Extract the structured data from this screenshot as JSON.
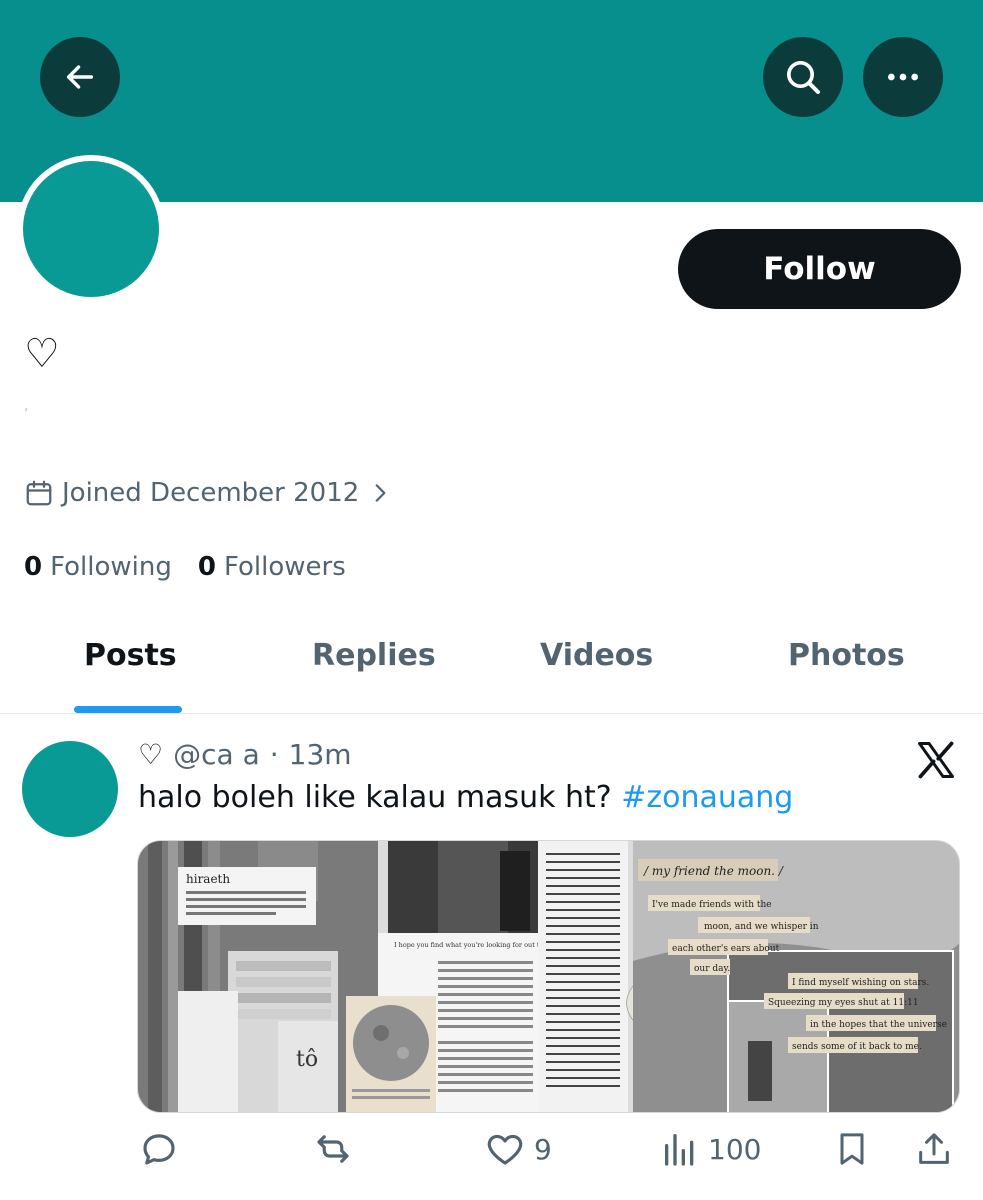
{
  "colors": {
    "banner": "#068f8c",
    "avatar": "#0a9a96",
    "button_dark": "#0b3b3b",
    "accent": "#1d9bf0",
    "text_primary": "#0f1419",
    "text_secondary": "#536471"
  },
  "header": {
    "back_icon": "arrow-left-icon",
    "search_icon": "search-icon",
    "more_icon": "more-horizontal-icon"
  },
  "profile": {
    "follow_label": "Follow",
    "display_name": "♡",
    "joined_text": "Joined December 2012",
    "following_count": "0",
    "following_label": "Following",
    "followers_count": "0",
    "followers_label": "Followers"
  },
  "tabs": [
    {
      "label": "Posts",
      "active": true
    },
    {
      "label": "Replies",
      "active": false
    },
    {
      "label": "Videos",
      "active": false
    },
    {
      "label": "Photos",
      "active": false
    }
  ],
  "post": {
    "name_icon": "♡",
    "handle": "@ca     a",
    "separator": "·",
    "time": "13m",
    "text": "halo boleh like kalau masuk ht?",
    "hashtag": "#zonauang",
    "collage_text": {
      "hiraeth_title": "hiraeth",
      "hiraeth_def": "(n.) a homesickness for a home to which you cannot return, a home which maybe never was; the nostalgia, the yearning, the grief for the lost places of your past",
      "moon_title": "/ my friend the moon. /",
      "moon_line1": "I've made friends with the",
      "moon_line2": "moon, and we whisper in",
      "moon_line3": "each other's ears about",
      "moon_line4": "our day.",
      "moon_line5": "I find myself wishing on stars.",
      "moon_line6": "Squeezing my eyes shut at 11:11",
      "moon_line7": "in the hopes that the universe",
      "moon_line8": "sends some of it back to me.",
      "letter_line1": "I hope you find what you're looking for out there."
    },
    "actions": {
      "reply_count": "",
      "repost_count": "",
      "like_count": "9",
      "views_count": "100"
    }
  }
}
